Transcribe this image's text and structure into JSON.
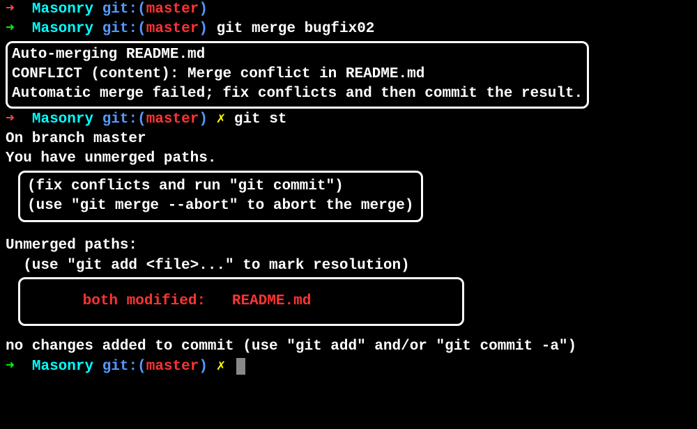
{
  "prompt0": {
    "arrow": "➜",
    "dir": "Masonry",
    "gitlabel": "git:(",
    "branch": "master",
    "gitclose": ")"
  },
  "prompt1": {
    "arrow": "➜",
    "dir": "Masonry",
    "gitlabel": "git:(",
    "branch": "master",
    "gitclose": ")",
    "command": "git merge bugfix02"
  },
  "mergeOutput": {
    "line1": "Auto-merging README.md",
    "line2": "CONFLICT (content): Merge conflict in README.md",
    "line3": "Automatic merge failed; fix conflicts and then commit the result."
  },
  "prompt2": {
    "arrow": "➜",
    "dir": "Masonry",
    "gitlabel": "git:(",
    "branch": "master",
    "gitclose": ")",
    "dirty": "✗",
    "command": "git st"
  },
  "status": {
    "onBranch": "On branch master",
    "unmerged": "You have unmerged paths."
  },
  "hints1": {
    "line1": "(fix conflicts and run \"git commit\")",
    "line2": "(use \"git merge --abort\" to abort the merge)"
  },
  "unmergedHeader": "Unmerged paths:",
  "addHint": "  (use \"git add <file>...\" to mark resolution)",
  "bothModified": {
    "label": "both modified:",
    "file": "README.md"
  },
  "noChanges": "no changes added to commit (use \"git add\" and/or \"git commit -a\")",
  "prompt3": {
    "arrow": "➜",
    "dir": "Masonry",
    "gitlabel": "git:(",
    "branch": "master",
    "gitclose": ")",
    "dirty": "✗"
  }
}
